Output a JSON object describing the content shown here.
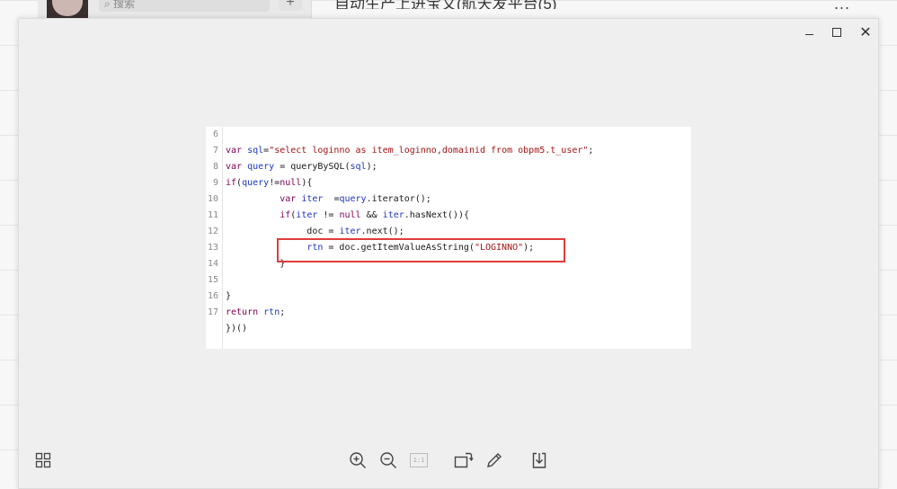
{
  "background": {
    "search_placeholder": "搜索",
    "add_label": "+",
    "chat_title": "自动生产上进宝文(航天发平台(5)",
    "more_label": "..."
  },
  "viewer": {
    "window_controls": [
      "minimize-icon",
      "maximize-icon",
      "close-icon"
    ],
    "close_label": "✕",
    "code_lines": [
      {
        "n": "6",
        "segments": []
      },
      {
        "n": "7",
        "segments": [
          {
            "t": "var ",
            "c": "kw"
          },
          {
            "t": "sql",
            "c": "id"
          },
          {
            "t": "=",
            "c": ""
          },
          {
            "t": "\"select loginno as item_loginno,domainid from obpm5.t_user\"",
            "c": "str"
          },
          {
            "t": ";",
            "c": ""
          }
        ]
      },
      {
        "n": "8",
        "segments": [
          {
            "t": "var ",
            "c": "kw"
          },
          {
            "t": "query",
            "c": "id"
          },
          {
            "t": " = queryBySQL(",
            "c": ""
          },
          {
            "t": "sql",
            "c": "id"
          },
          {
            "t": ");",
            "c": ""
          }
        ]
      },
      {
        "n": "9",
        "segments": [
          {
            "t": "if",
            "c": "kw"
          },
          {
            "t": "(",
            "c": ""
          },
          {
            "t": "query",
            "c": "id"
          },
          {
            "t": "!=",
            "c": ""
          },
          {
            "t": "null",
            "c": "kw"
          },
          {
            "t": "){",
            "c": ""
          }
        ]
      },
      {
        "n": "10",
        "segments": [
          {
            "t": "          ",
            "c": ""
          },
          {
            "t": "var ",
            "c": "kw"
          },
          {
            "t": "iter",
            "c": "id"
          },
          {
            "t": "  =",
            "c": ""
          },
          {
            "t": "query",
            "c": "id"
          },
          {
            "t": ".iterator();",
            "c": ""
          }
        ]
      },
      {
        "n": "11",
        "segments": [
          {
            "t": "          ",
            "c": ""
          },
          {
            "t": "if",
            "c": "kw"
          },
          {
            "t": "(",
            "c": ""
          },
          {
            "t": "iter",
            "c": "id"
          },
          {
            "t": " != ",
            "c": ""
          },
          {
            "t": "null",
            "c": "kw"
          },
          {
            "t": " && ",
            "c": ""
          },
          {
            "t": "iter",
            "c": "id"
          },
          {
            "t": ".hasNext()){",
            "c": ""
          }
        ]
      },
      {
        "n": "12",
        "segments": [
          {
            "t": "               doc = ",
            "c": ""
          },
          {
            "t": "iter",
            "c": "id"
          },
          {
            "t": ".next();",
            "c": ""
          }
        ]
      },
      {
        "n": "13",
        "segments": [
          {
            "t": "               ",
            "c": ""
          },
          {
            "t": "rtn",
            "c": "id"
          },
          {
            "t": " = doc.getItemValueAsString(",
            "c": ""
          },
          {
            "t": "\"LOGINNO\"",
            "c": "str"
          },
          {
            "t": ");",
            "c": ""
          }
        ]
      },
      {
        "n": "14",
        "segments": [
          {
            "t": "          }",
            "c": ""
          }
        ]
      },
      {
        "n": "15",
        "segments": []
      },
      {
        "n": "16",
        "segments": [
          {
            "t": "}",
            "c": ""
          }
        ]
      },
      {
        "n": "17",
        "segments": [
          {
            "t": "return ",
            "c": "kw"
          },
          {
            "t": "rtn",
            "c": "id"
          },
          {
            "t": ";",
            "c": ""
          }
        ]
      },
      {
        "n": "",
        "segments": [
          {
            "t": "})()",
            "c": ""
          }
        ]
      }
    ],
    "highlight_color": "#e03c3c",
    "toolbar_icons": [
      "grid-view-icon",
      "zoom-in-icon",
      "zoom-out-icon",
      "actual-size-icon",
      "rotate-icon",
      "edit-icon",
      "download-icon"
    ],
    "actual_size_label": "1:1"
  }
}
